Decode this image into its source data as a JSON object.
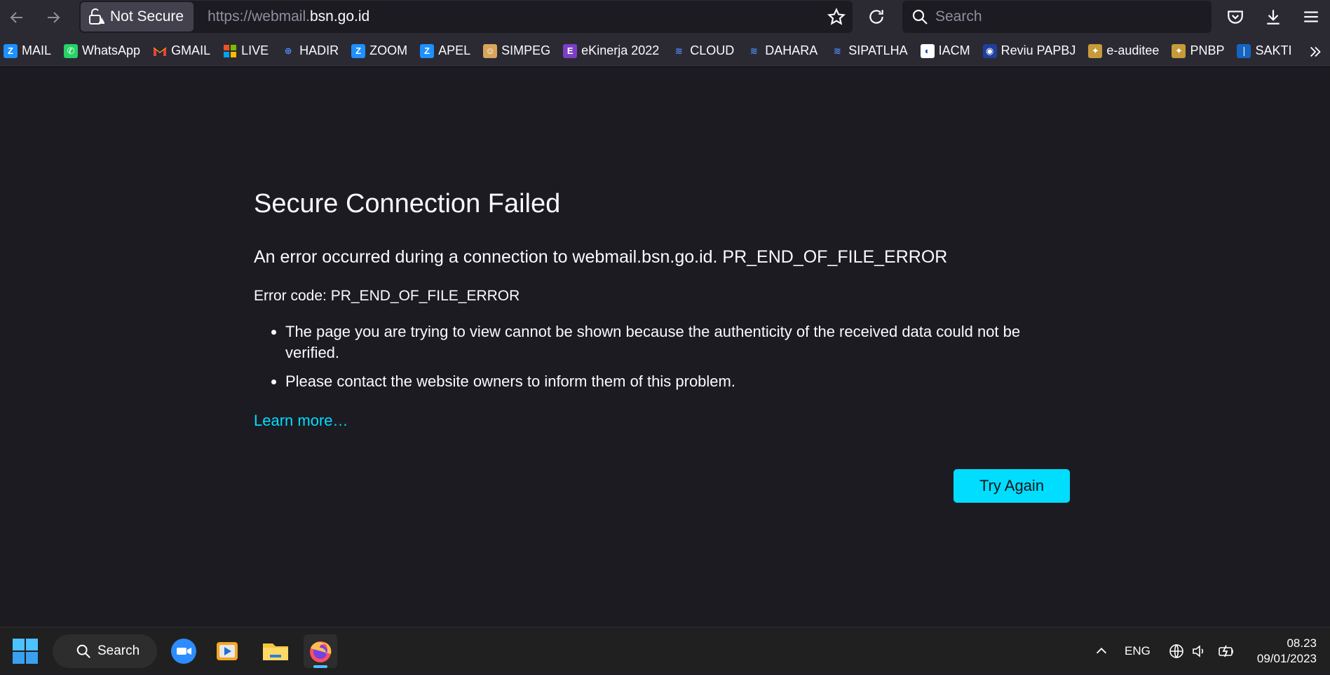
{
  "toolbar": {
    "security_label": "Not Secure",
    "url_prefix": "https://webmail.",
    "url_domain": "bsn.go.id",
    "search_placeholder": "Search"
  },
  "bookmarks": [
    {
      "label": "MAIL",
      "icon": "zimbra-icon",
      "color": "#1e90ff",
      "glyph": "Z"
    },
    {
      "label": "WhatsApp",
      "icon": "whatsapp-icon",
      "color": "#25d366",
      "glyph": "✆"
    },
    {
      "label": "GMAIL",
      "icon": "gmail-icon",
      "color": "#2b2a33",
      "glyph": "M"
    },
    {
      "label": "LIVE",
      "icon": "microsoft-icon",
      "color": "#2b2a33",
      "glyph": ""
    },
    {
      "label": "HADIR",
      "icon": "globe-icon",
      "color": "#2b2a33",
      "glyph": "⊕"
    },
    {
      "label": "ZOOM",
      "icon": "zimbra-icon",
      "color": "#1e90ff",
      "glyph": "Z"
    },
    {
      "label": "APEL",
      "icon": "zimbra-icon",
      "color": "#1e90ff",
      "glyph": "Z"
    },
    {
      "label": "SIMPEG",
      "icon": "user-icon",
      "color": "#d9a45b",
      "glyph": "☺"
    },
    {
      "label": "eKinerja 2022",
      "icon": "ekinerja-icon",
      "color": "#7b3fc4",
      "glyph": "E"
    },
    {
      "label": "CLOUD",
      "icon": "bsn-icon",
      "color": "#2b2a33",
      "glyph": "≋"
    },
    {
      "label": "DAHARA",
      "icon": "bsn-icon",
      "color": "#2b2a33",
      "glyph": "≋"
    },
    {
      "label": "SIPATLHA",
      "icon": "bsn-icon",
      "color": "#2b2a33",
      "glyph": "≋"
    },
    {
      "label": "IACM",
      "icon": "iacm-icon",
      "color": "#ffffff",
      "glyph": "◐"
    },
    {
      "label": "Reviu PAPBJ",
      "icon": "papbj-icon",
      "color": "#1f3f9e",
      "glyph": "◉"
    },
    {
      "label": "e-auditee",
      "icon": "emblem-icon",
      "color": "#c79a3a",
      "glyph": "✦"
    },
    {
      "label": "PNBP",
      "icon": "emblem-icon",
      "color": "#c79a3a",
      "glyph": "✦"
    },
    {
      "label": "SAKTI",
      "icon": "sakti-icon",
      "color": "#1565c0",
      "glyph": "❘"
    }
  ],
  "error": {
    "title": "Secure Connection Failed",
    "short_desc": "An error occurred during a connection to webmail.bsn.go.id. PR_END_OF_FILE_ERROR",
    "code_line": "Error code: PR_END_OF_FILE_ERROR",
    "bullets": [
      "The page you are trying to view cannot be shown because the authenticity of the received data could not be verified.",
      "Please contact the website owners to inform them of this problem."
    ],
    "learn_more": "Learn more…",
    "try_again": "Try Again"
  },
  "taskbar": {
    "search_label": "Search",
    "language": "ENG",
    "time": "08.23",
    "date": "09/01/2023"
  }
}
